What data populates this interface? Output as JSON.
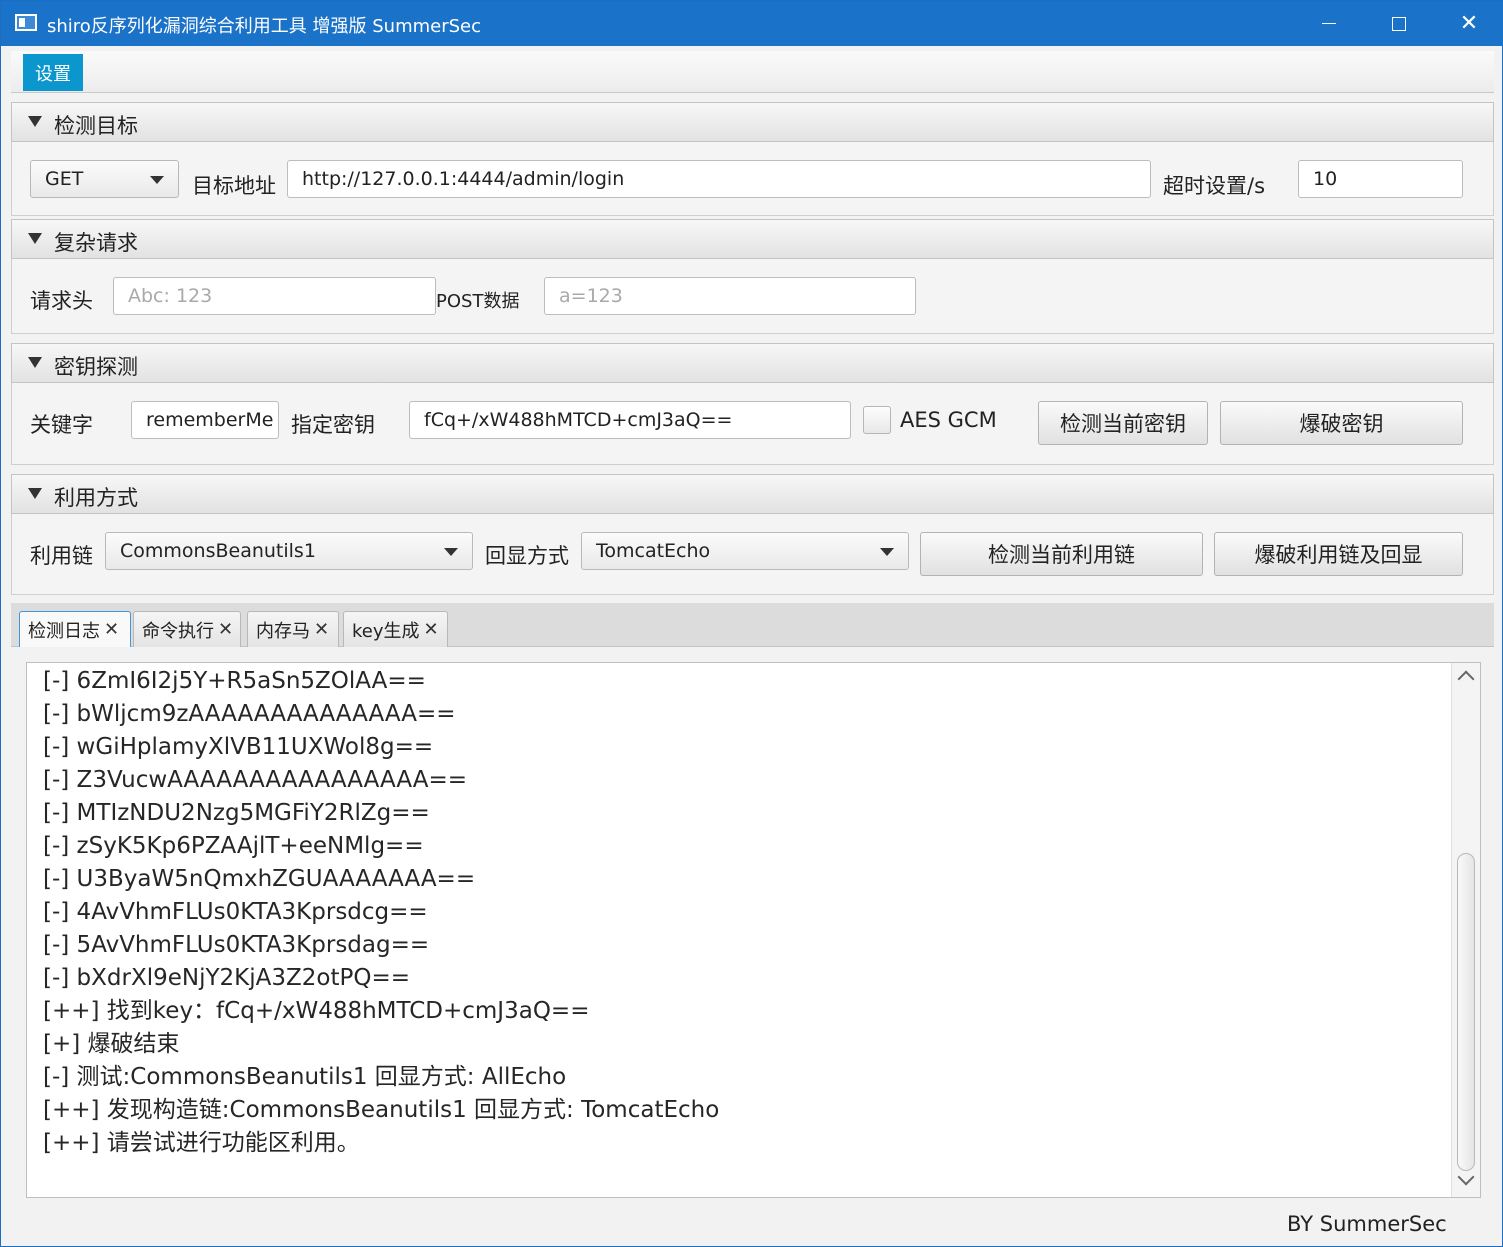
{
  "window": {
    "title": "shiro反序列化漏洞综合利用工具 增强版 SummerSec"
  },
  "menu": {
    "items": [
      "设置"
    ]
  },
  "target": {
    "header": "检测目标",
    "method": "GET",
    "url_label": "目标地址",
    "url": "http://127.0.0.1:4444/admin/login",
    "timeout_label": "超时设置/s",
    "timeout": "10"
  },
  "complex": {
    "header": "复杂请求",
    "headers_label": "请求头",
    "headers_placeholder": "Abc: 123",
    "post_label": "POST数据",
    "post_placeholder": "a=123"
  },
  "key": {
    "header": "密钥探测",
    "keyword_label": "关键字",
    "keyword": "rememberMe",
    "key_label": "指定密钥",
    "key_value": "fCq+/xW488hMTCD+cmJ3aQ==",
    "aes_gcm_label": "AES GCM",
    "aes_gcm_checked": false,
    "detect_btn": "检测当前密钥",
    "brute_btn": "爆破密钥"
  },
  "exploit": {
    "header": "利用方式",
    "chain_label": "利用链",
    "chain": "CommonsBeanutils1",
    "echo_label": "回显方式",
    "echo": "TomcatEcho",
    "detect_btn": "检测当前利用链",
    "brute_btn": "爆破利用链及回显"
  },
  "tabs": [
    {
      "label": "检测日志",
      "active": true
    },
    {
      "label": "命令执行",
      "active": false
    },
    {
      "label": "内存马",
      "active": false
    },
    {
      "label": "key生成",
      "active": false
    }
  ],
  "log": [
    "[-] 6ZmI6I2j5Y+R5aSn5ZOlAA==",
    "[-] bWljcm9zAAAAAAAAAAAAAA==",
    "[-] wGiHplamyXlVB11UXWol8g==",
    "[-] Z3VucwAAAAAAAAAAAAAAAA==",
    "[-] MTIzNDU2Nzg5MGFiY2RlZg==",
    "[-] zSyK5Kp6PZAAjlT+eeNMlg==",
    "[-] U3ByaW5nQmxhZGUAAAAAAA==",
    "[-] 4AvVhmFLUs0KTA3Kprsdcg==",
    "[-] 5AvVhmFLUs0KTA3Kprsdag==",
    "[-] bXdrXl9eNjY2KjA3Z2otPQ==",
    "[++] 找到key：fCq+/xW488hMTCD+cmJ3aQ==",
    "[+] 爆破结束",
    "[-] 测试:CommonsBeanutils1  回显方式: AllEcho",
    "[++] 发现构造链:CommonsBeanutils1  回显方式: TomcatEcho",
    "[++] 请尝试进行功能区利用。"
  ],
  "footer": {
    "credit": "BY   SummerSec"
  },
  "colors": {
    "titlebar": "#1a72c9",
    "menu_active": "#0b96cd",
    "tab_active_border": "#3f96d8"
  }
}
